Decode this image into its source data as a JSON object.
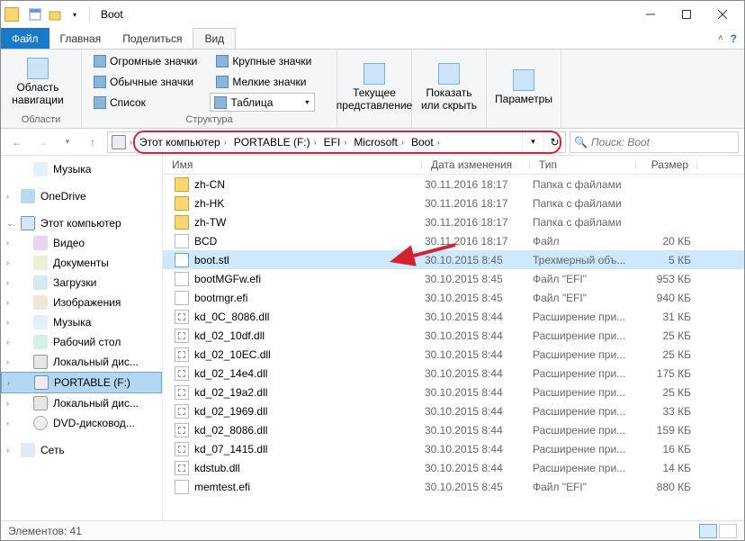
{
  "window": {
    "title": "Boot"
  },
  "tabs": {
    "file": "Файл",
    "home": "Главная",
    "share": "Поделиться",
    "view": "Вид"
  },
  "ribbon": {
    "panes_group": "Области",
    "layout_group": "Структура",
    "current_group": "",
    "nav_pane": "Область\nнавигации",
    "layouts": {
      "huge": "Огромные значки",
      "large": "Крупные значки",
      "normal": "Обычные значки",
      "small": "Мелкие значки",
      "list": "Список",
      "table": "Таблица"
    },
    "current_view": "Текущее\nпредставление",
    "show_hide": "Показать\nили скрыть",
    "options": "Параметры"
  },
  "breadcrumb": {
    "root": "Этот компьютер",
    "drive": "PORTABLE (F:)",
    "p1": "EFI",
    "p2": "Microsoft",
    "p3": "Boot"
  },
  "search": {
    "placeholder": "Поиск: Boot"
  },
  "nav": {
    "music": "Музыка",
    "onedrive": "OneDrive",
    "pc": "Этот компьютер",
    "video": "Видео",
    "docs": "Документы",
    "downloads": "Загрузки",
    "images": "Изображения",
    "music2": "Музыка",
    "desktop": "Рабочий стол",
    "localdisk": "Локальный дис...",
    "portable": "PORTABLE (F:)",
    "localdisk2": "Локальный дис...",
    "dvd": "DVD-дисковод...",
    "net": "Сеть"
  },
  "columns": {
    "name": "Имя",
    "date": "Дата изменения",
    "type": "Тип",
    "size": "Размер"
  },
  "files": [
    {
      "icon": "folder",
      "name": "zh-CN",
      "date": "30.11.2016 18:17",
      "type": "Папка с файлами",
      "size": ""
    },
    {
      "icon": "folder",
      "name": "zh-HK",
      "date": "30.11.2016 18:17",
      "type": "Папка с файлами",
      "size": ""
    },
    {
      "icon": "folder",
      "name": "zh-TW",
      "date": "30.11.2016 18:17",
      "type": "Папка с файлами",
      "size": ""
    },
    {
      "icon": "file",
      "name": "BCD",
      "date": "30.11.2016 18:17",
      "type": "Файл",
      "size": "20 КБ"
    },
    {
      "icon": "stl",
      "name": "boot.stl",
      "date": "30.10.2015 8:45",
      "type": "Трехмерный объ...",
      "size": "5 КБ",
      "sel": true
    },
    {
      "icon": "file",
      "name": "bootMGFw.efi",
      "date": "30.10.2015 8:45",
      "type": "Файл \"EFI\"",
      "size": "953 КБ"
    },
    {
      "icon": "file",
      "name": "bootmgr.efi",
      "date": "30.10.2015 8:45",
      "type": "Файл \"EFI\"",
      "size": "940 КБ"
    },
    {
      "icon": "dll",
      "name": "kd_0C_8086.dll",
      "date": "30.10.2015 8:44",
      "type": "Расширение при...",
      "size": "31 КБ"
    },
    {
      "icon": "dll",
      "name": "kd_02_10df.dll",
      "date": "30.10.2015 8:44",
      "type": "Расширение при...",
      "size": "25 КБ"
    },
    {
      "icon": "dll",
      "name": "kd_02_10EC.dll",
      "date": "30.10.2015 8:44",
      "type": "Расширение при...",
      "size": "25 КБ"
    },
    {
      "icon": "dll",
      "name": "kd_02_14e4.dll",
      "date": "30.10.2015 8:44",
      "type": "Расширение при...",
      "size": "175 КБ"
    },
    {
      "icon": "dll",
      "name": "kd_02_19a2.dll",
      "date": "30.10.2015 8:44",
      "type": "Расширение при...",
      "size": "25 КБ"
    },
    {
      "icon": "dll",
      "name": "kd_02_1969.dll",
      "date": "30.10.2015 8:44",
      "type": "Расширение при...",
      "size": "33 КБ"
    },
    {
      "icon": "dll",
      "name": "kd_02_8086.dll",
      "date": "30.10.2015 8:44",
      "type": "Расширение при...",
      "size": "159 КБ"
    },
    {
      "icon": "dll",
      "name": "kd_07_1415.dll",
      "date": "30.10.2015 8:44",
      "type": "Расширение при...",
      "size": "16 КБ"
    },
    {
      "icon": "dll",
      "name": "kdstub.dll",
      "date": "30.10.2015 8:44",
      "type": "Расширение при...",
      "size": "14 КБ"
    },
    {
      "icon": "file",
      "name": "memtest.efi",
      "date": "30.10.2015 8:45",
      "type": "Файл \"EFI\"",
      "size": "880 КБ"
    }
  ],
  "status": {
    "count": "Элементов: 41"
  }
}
